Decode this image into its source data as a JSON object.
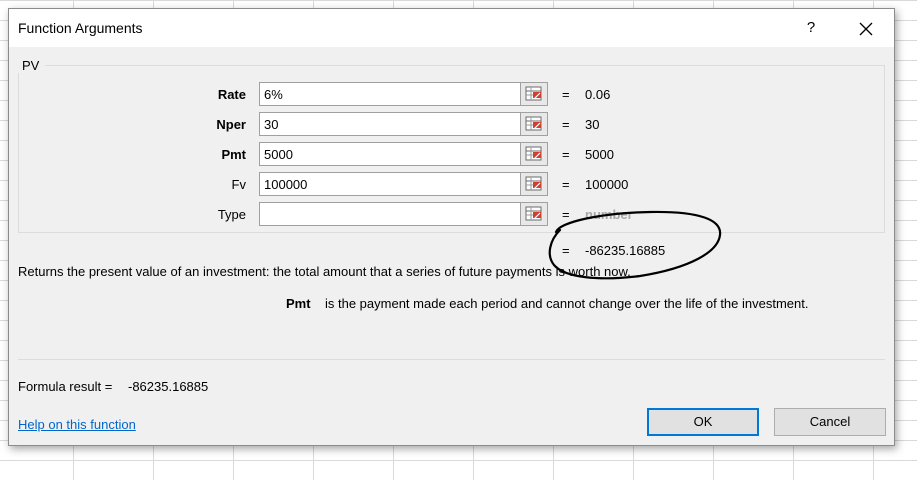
{
  "dialog": {
    "title": "Function Arguments",
    "help_glyph": "?",
    "function_name": "PV"
  },
  "arguments": [
    {
      "name": "Rate",
      "value": "6%",
      "result": "0.06",
      "bold": true
    },
    {
      "name": "Nper",
      "value": "30",
      "result": "30",
      "bold": true
    },
    {
      "name": "Pmt",
      "value": "5000",
      "result": "5000",
      "bold": true
    },
    {
      "name": "Fv",
      "value": "100000",
      "result": "100000",
      "bold": false
    },
    {
      "name": "Type",
      "value": "",
      "result": "number",
      "bold": false
    }
  ],
  "equals_sign": "=",
  "function_result": "-86235.16885",
  "description": "Returns the present value of an investment: the total amount that a series of future payments is worth now.",
  "arg_help": {
    "name": "Pmt",
    "text": "is the payment made each period and cannot change over the life of the investment."
  },
  "formula_result": {
    "label": "Formula result =",
    "value": "-86235.16885"
  },
  "help_link": "Help on this function",
  "buttons": {
    "ok": "OK",
    "cancel": "Cancel"
  },
  "icons": {
    "close": "close-icon",
    "collapse": "range-selector-icon"
  }
}
